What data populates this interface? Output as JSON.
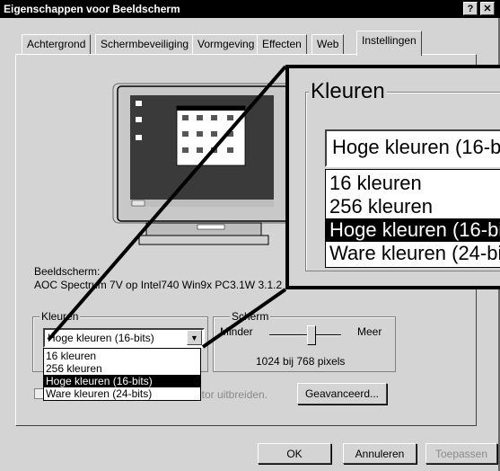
{
  "window": {
    "title": "Eigenschappen voor Beeldscherm",
    "help_button": "?",
    "close_button": "✕"
  },
  "tabs": [
    {
      "label": "Achtergrond"
    },
    {
      "label": "Schermbeveiliging"
    },
    {
      "label": "Vormgeving"
    },
    {
      "label": "Effecten"
    },
    {
      "label": "Web"
    },
    {
      "label": "Instellingen"
    }
  ],
  "active_tab": "Instellingen",
  "monitor": {
    "preview_icon": "monitor-preview-icon"
  },
  "display": {
    "label": "Beeldscherm:",
    "value": "AOC Spectrum 7V op Intel740 Win9x PC3.1W 3.1.2"
  },
  "colors": {
    "legend": "Kleuren",
    "selected": "Hoge kleuren (16-bits)",
    "options": [
      "16 kleuren",
      "256 kleuren",
      "Hoge kleuren (16-bits)",
      "Ware kleuren (24-bits)"
    ],
    "selected_index": 2
  },
  "screen_area": {
    "legend": "Scherm",
    "min_label": "Minder",
    "max_label": "Meer",
    "resolution": "1024 bij 768 pixels"
  },
  "extend_checkbox": {
    "label_fragment": "itor uitbreiden."
  },
  "advanced_button": "Geavanceerd...",
  "footer": {
    "ok": "OK",
    "cancel": "Annuleren",
    "apply": "Toepassen"
  },
  "theme": {
    "face": "#d4d4d4",
    "titlebar": "#000000",
    "selection": "#000000"
  }
}
